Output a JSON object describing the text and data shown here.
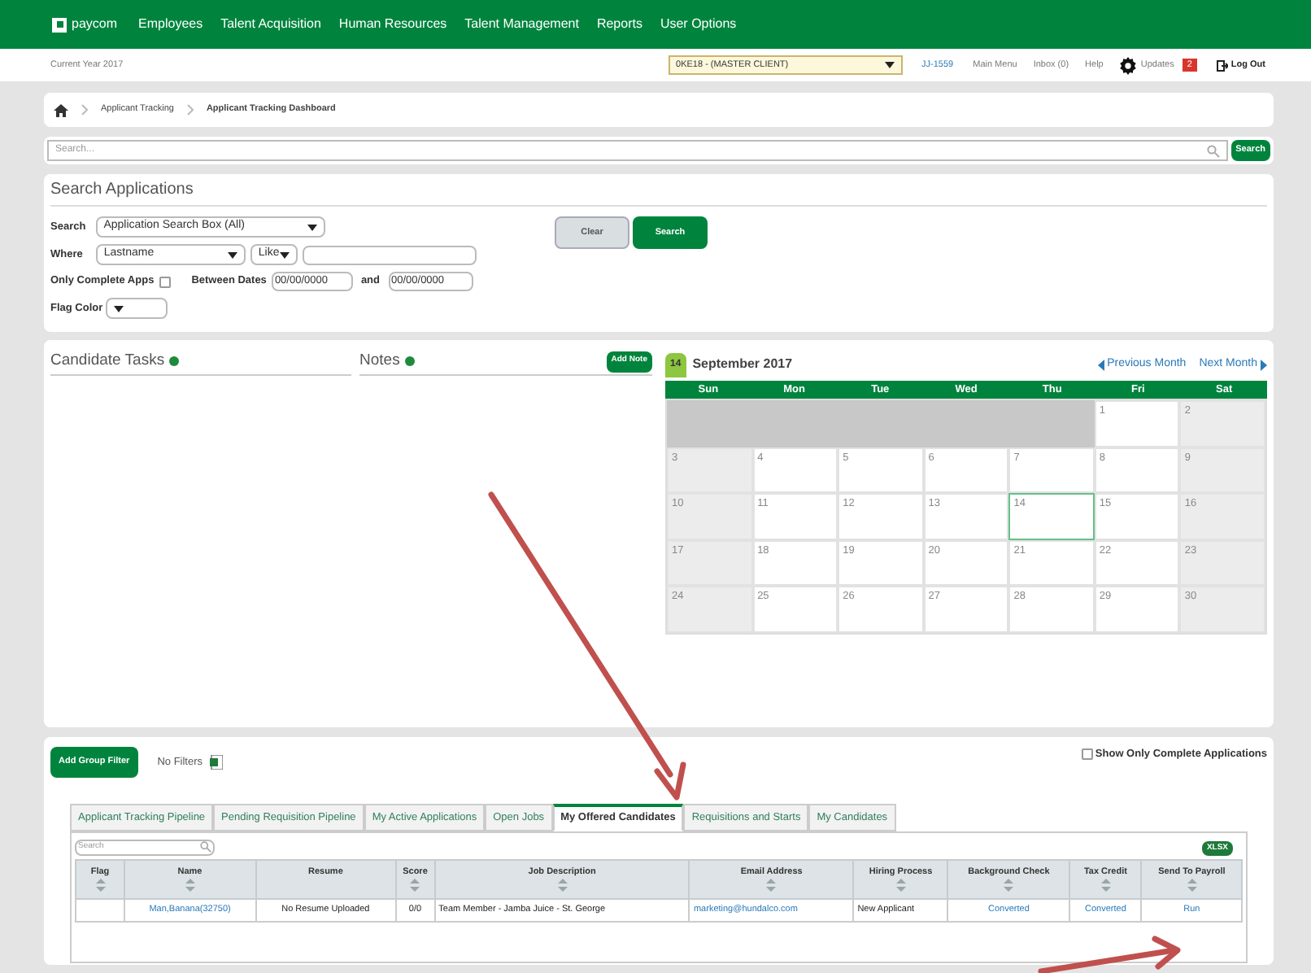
{
  "nav": {
    "logo": "paycom",
    "items": [
      "Employees",
      "Talent Acquisition",
      "Human Resources",
      "Talent Management",
      "Reports",
      "User Options"
    ]
  },
  "subheader": {
    "current_year": "Current Year 2017",
    "client": "0KE18 - (MASTER CLIENT)",
    "user_link": "JJ-1559",
    "links": [
      "Main Menu",
      "Inbox (0)",
      "Help"
    ],
    "updates": "Updates",
    "updates_count": "2",
    "logout": "Log Out"
  },
  "breadcrumbs": [
    "Applicant Tracking",
    "Applicant Tracking Dashboard"
  ],
  "top_search": {
    "placeholder": "Search...",
    "button": "Search"
  },
  "search_applications": {
    "title": "Search Applications",
    "search_label": "Search",
    "search_value": "Application Search Box (All)",
    "where_label": "Where",
    "where_field": "Lastname",
    "where_op": "Like",
    "complete_label": "Only Complete Apps",
    "complete_checked": false,
    "between_label": "Between Dates",
    "date_from": "00/00/0000",
    "and_label": "and",
    "date_to": "00/00/0000",
    "flag_label": "Flag Color",
    "clear_button": "Clear",
    "search_button": "Search"
  },
  "tasks": {
    "title": "Candidate Tasks"
  },
  "notes": {
    "title": "Notes",
    "add_button": "Add Note"
  },
  "calendar": {
    "today_badge": "14",
    "title": "September 2017",
    "prev": "Previous Month",
    "next": "Next Month",
    "weekdays": [
      "Sun",
      "Mon",
      "Tue",
      "Wed",
      "Thu",
      "Fri",
      "Sat"
    ],
    "weeks": [
      [
        {
          "kind": "blank"
        },
        {
          "kind": "blank"
        },
        {
          "kind": "blank"
        },
        {
          "kind": "blank"
        },
        {
          "kind": "blank"
        },
        {
          "kind": "day",
          "day": "1",
          "selected": false
        },
        {
          "kind": "day",
          "day": "2",
          "selected": false
        }
      ],
      [
        {
          "kind": "day",
          "day": "3",
          "selected": false
        },
        {
          "kind": "day",
          "day": "4",
          "selected": false
        },
        {
          "kind": "day",
          "day": "5",
          "selected": false
        },
        {
          "kind": "day",
          "day": "6",
          "selected": false
        },
        {
          "kind": "day",
          "day": "7",
          "selected": false
        },
        {
          "kind": "day",
          "day": "8",
          "selected": false
        },
        {
          "kind": "day",
          "day": "9",
          "selected": false
        }
      ],
      [
        {
          "kind": "day",
          "day": "10",
          "selected": false
        },
        {
          "kind": "day",
          "day": "11",
          "selected": false
        },
        {
          "kind": "day",
          "day": "12",
          "selected": false
        },
        {
          "kind": "day",
          "day": "13",
          "selected": false
        },
        {
          "kind": "day",
          "day": "14",
          "selected": true
        },
        {
          "kind": "day",
          "day": "15",
          "selected": false
        },
        {
          "kind": "day",
          "day": "16",
          "selected": false
        }
      ],
      [
        {
          "kind": "day",
          "day": "17",
          "selected": false
        },
        {
          "kind": "day",
          "day": "18",
          "selected": false
        },
        {
          "kind": "day",
          "day": "19",
          "selected": false
        },
        {
          "kind": "day",
          "day": "20",
          "selected": false
        },
        {
          "kind": "day",
          "day": "21",
          "selected": false
        },
        {
          "kind": "day",
          "day": "22",
          "selected": false
        },
        {
          "kind": "day",
          "day": "23",
          "selected": false
        }
      ],
      [
        {
          "kind": "day",
          "day": "24",
          "selected": false
        },
        {
          "kind": "day",
          "day": "25",
          "selected": false
        },
        {
          "kind": "day",
          "day": "26",
          "selected": false
        },
        {
          "kind": "day",
          "day": "27",
          "selected": false
        },
        {
          "kind": "day",
          "day": "28",
          "selected": false
        },
        {
          "kind": "day",
          "day": "29",
          "selected": false
        },
        {
          "kind": "day",
          "day": "30",
          "selected": false
        }
      ]
    ]
  },
  "pipeline": {
    "add_filter": "Add Group Filter",
    "filters": "No Filters",
    "show_complete_label": "Show Only Complete Applications",
    "show_complete_checked": false,
    "tabs": [
      {
        "label": "Applicant Tracking Pipeline",
        "selected": false
      },
      {
        "label": "Pending Requisition Pipeline",
        "selected": false
      },
      {
        "label": "My Active Applications",
        "selected": false
      },
      {
        "label": "Open Jobs",
        "selected": false
      },
      {
        "label": "My Offered Candidates",
        "selected": true
      },
      {
        "label": "Requisitions and Starts",
        "selected": false
      },
      {
        "label": "My Candidates",
        "selected": false
      }
    ],
    "table_search": {
      "placeholder": "Search"
    },
    "export_button": "XLSX",
    "table": {
      "columns": [
        {
          "label": "Flag",
          "sortable": true
        },
        {
          "label": "Name",
          "sortable": true
        },
        {
          "label": "Resume",
          "sortable": false
        },
        {
          "label": "Score",
          "sortable": true
        },
        {
          "label": "Job Description",
          "sortable": true
        },
        {
          "label": "Email Address",
          "sortable": true
        },
        {
          "label": "Hiring Process",
          "sortable": true
        },
        {
          "label": "Background Check",
          "sortable": true
        },
        {
          "label": "Tax Credit",
          "sortable": true
        },
        {
          "label": "Send To Payroll",
          "sortable": true
        }
      ],
      "rows": [
        [
          {
            "kind": "empty"
          },
          {
            "kind": "link",
            "text": "Man,Banana(32750)"
          },
          {
            "kind": "text",
            "text": "No Resume Uploaded"
          },
          {
            "kind": "text",
            "text": "0/0"
          },
          {
            "kind": "text",
            "text": "Team Member - Jamba Juice - St. George"
          },
          {
            "kind": "link",
            "text": "marketing@hundalco.com"
          },
          {
            "kind": "text",
            "text": "New Applicant"
          },
          {
            "kind": "link",
            "text": "Converted"
          },
          {
            "kind": "link",
            "text": "Converted"
          },
          {
            "kind": "link",
            "text": "Run"
          }
        ]
      ]
    }
  }
}
